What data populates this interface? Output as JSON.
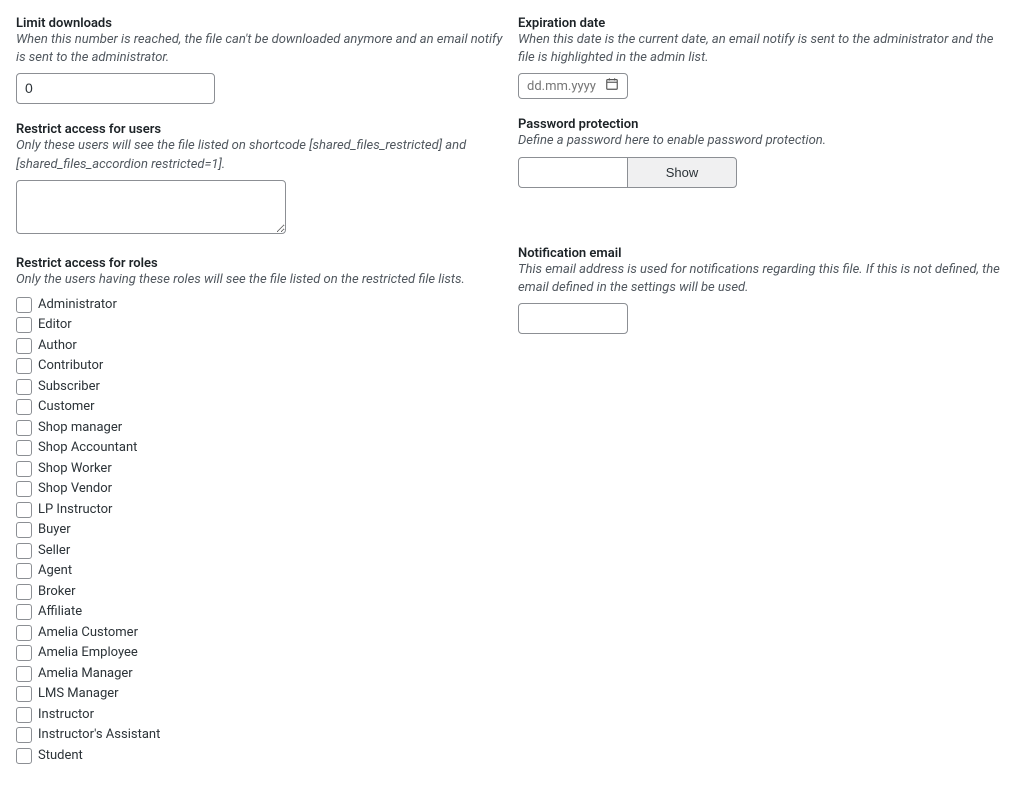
{
  "left": {
    "limitDownloads": {
      "label": "Limit downloads",
      "description": "When this number is reached, the file can't be downloaded anymore and an email notify is sent to the administrator.",
      "value": "0"
    },
    "restrictUsers": {
      "label": "Restrict access for users",
      "description": "Only these users will see the file listed on shortcode [shared_files_restricted] and [shared_files_accordion restricted=1].",
      "value": ""
    },
    "restrictRoles": {
      "label": "Restrict access for roles",
      "description": "Only the users having these roles will see the file listed on the restricted file lists.",
      "roles": [
        "Administrator",
        "Editor",
        "Author",
        "Contributor",
        "Subscriber",
        "Customer",
        "Shop manager",
        "Shop Accountant",
        "Shop Worker",
        "Shop Vendor",
        "LP Instructor",
        "Buyer",
        "Seller",
        "Agent",
        "Broker",
        "Affiliate",
        "Amelia Customer",
        "Amelia Employee",
        "Amelia Manager",
        "LMS Manager",
        "Instructor",
        "Instructor's Assistant",
        "Student"
      ]
    }
  },
  "right": {
    "expirationDate": {
      "label": "Expiration date",
      "description": "When this date is the current date, an email notify is sent to the administrator and the file is highlighted in the admin list.",
      "placeholder": "dd.mm.yyyy"
    },
    "passwordProtection": {
      "label": "Password protection",
      "description": "Define a password here to enable password protection.",
      "showLabel": "Show"
    },
    "notificationEmail": {
      "label": "Notification email",
      "description": "This email address is used for notifications regarding this file. If this is not defined, the email defined in the settings will be used."
    }
  }
}
